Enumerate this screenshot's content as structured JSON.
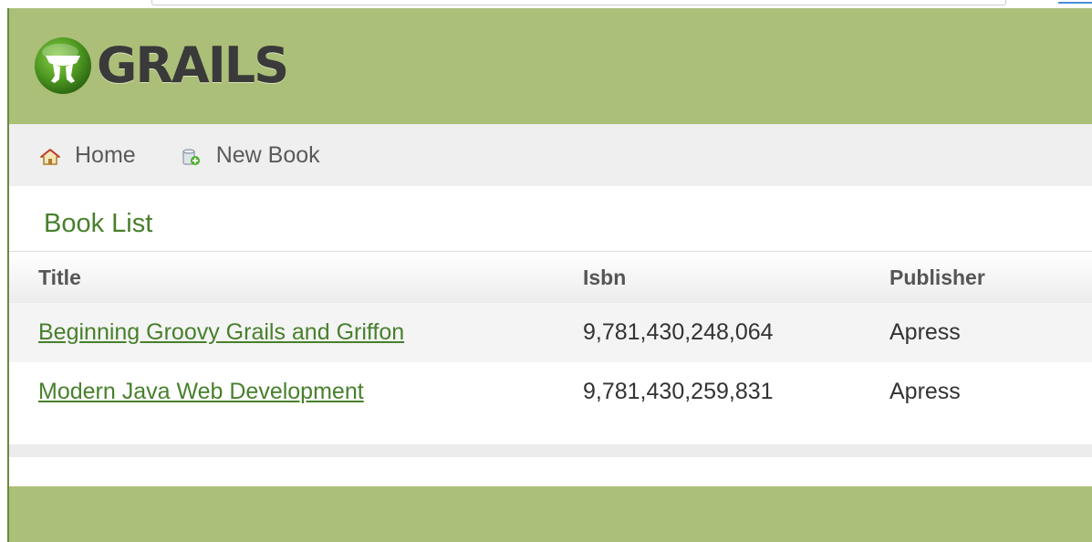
{
  "app": {
    "logo_text": "GRAILS"
  },
  "nav": {
    "home_label": "Home",
    "new_book_label": "New Book"
  },
  "page": {
    "title": "Book List"
  },
  "table": {
    "columns": [
      "Title",
      "Isbn",
      "Publisher"
    ],
    "rows": [
      {
        "title": "Beginning Groovy Grails and Griffon",
        "isbn": "9,781,430,248,064",
        "publisher": "Apress"
      },
      {
        "title": "Modern Java Web Development",
        "isbn": "9,781,430,259,831",
        "publisher": "Apress"
      }
    ]
  },
  "colors": {
    "header_green": "#abbf78",
    "title_green": "#48802c",
    "nav_bg": "#efefef"
  },
  "icons": {
    "home": "home-icon",
    "new_book": "database-add-icon"
  }
}
